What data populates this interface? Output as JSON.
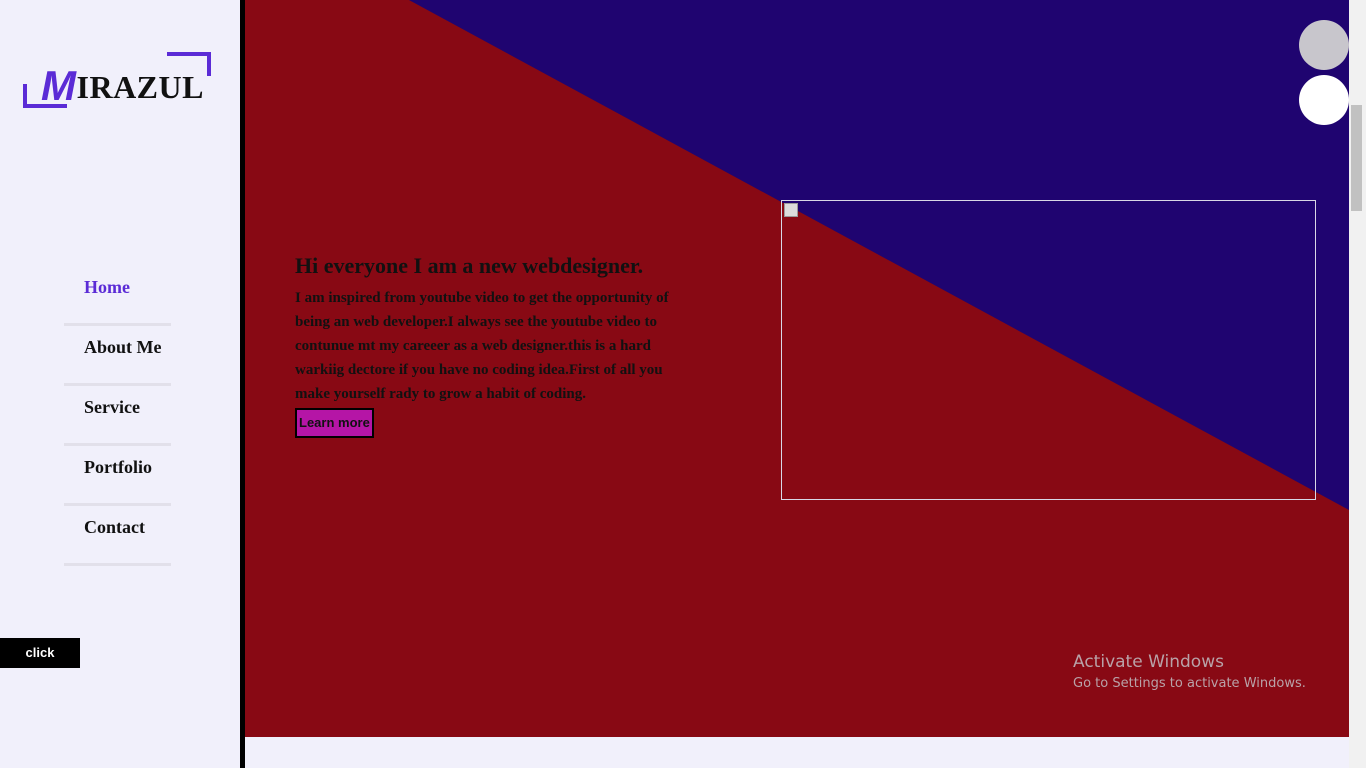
{
  "logo": {
    "initial": "M",
    "rest": "IRAZUL"
  },
  "nav": {
    "items": [
      {
        "label": "Home",
        "active": true
      },
      {
        "label": "About Me"
      },
      {
        "label": "Service"
      },
      {
        "label": "Portfolio"
      },
      {
        "label": "Contact"
      }
    ]
  },
  "sidebar": {
    "click_label": "click"
  },
  "hero": {
    "heading": "Hi everyone I am a new webdesigner.",
    "paragraph": "I am inspired from youtube video to get the opportunity of being an web developer.I always see the youtube video to contunue mt my careeer as a web designer.this is a hard warkiig dectore if you have no coding idea.First of all you make yourself rady to grow a habit of coding.",
    "button_label": "Learn more"
  },
  "watermark": {
    "title": "Activate Windows",
    "subtitle": "Go to Settings to activate Windows."
  },
  "colors": {
    "accent": "#5b2bd6",
    "hero_red": "#880914",
    "hero_navy": "#1f0470",
    "button": "#b515a6",
    "sidebar_bg": "#f1f0fb"
  }
}
